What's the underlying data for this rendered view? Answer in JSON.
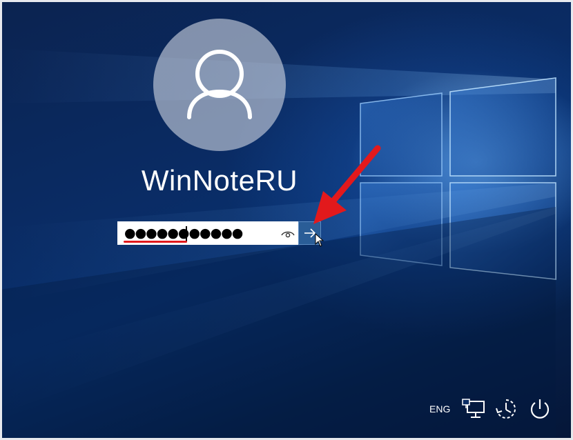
{
  "user": {
    "name": "WinNoteRU",
    "avatar_icon": "user-silhouette-icon"
  },
  "password": {
    "masked_value": "●●●●●●●●●●●",
    "reveal_icon": "eye-icon",
    "submit_icon": "arrow-right-icon"
  },
  "tray": {
    "language": "ENG",
    "network_icon": "network-icon",
    "ease_of_access_icon": "ease-of-access-icon",
    "power_icon": "power-icon"
  },
  "colors": {
    "background": "#0a2b63",
    "submit_button": "#2a5d97",
    "annotation": "#e2191c"
  }
}
